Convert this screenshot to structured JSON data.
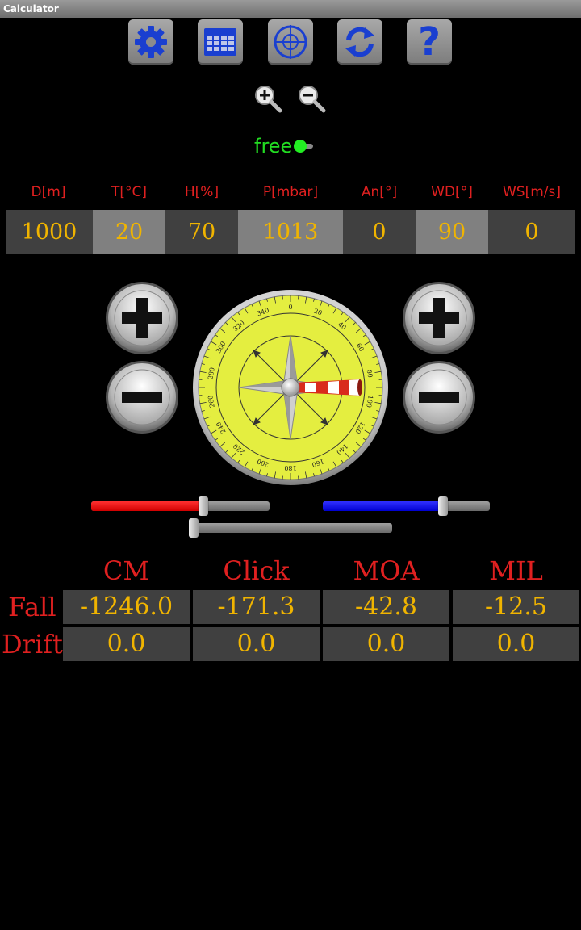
{
  "window": {
    "title": "Calculator"
  },
  "toolbar": [
    {
      "icon": "gear-icon"
    },
    {
      "icon": "table-icon"
    },
    {
      "icon": "crosshair-icon"
    },
    {
      "icon": "refresh-icon"
    },
    {
      "icon": "help-icon",
      "label": "?"
    }
  ],
  "zoom": {
    "in_icon": "zoom-in-icon",
    "out_icon": "zoom-out-icon"
  },
  "mode": {
    "label": "free",
    "enabled": true
  },
  "inputs": {
    "headers": [
      "D[m]",
      "T[°C]",
      "H[%]",
      "P[mbar]",
      "An[°]",
      "WD[°]",
      "WS[m/s]"
    ],
    "values": [
      "1000",
      "20",
      "70",
      "1013",
      "0",
      "90",
      "0"
    ]
  },
  "compass": {
    "wind_direction_deg": 90,
    "tick_labels": [
      "0",
      "20",
      "40",
      "60",
      "80",
      "100",
      "120",
      "140",
      "160",
      "180",
      "200",
      "220",
      "240",
      "260",
      "280",
      "300",
      "320",
      "340"
    ]
  },
  "sliders": {
    "red_level": 0.6,
    "blue_level": 0.69,
    "bottom_level": 0.0
  },
  "results": {
    "columns": [
      "CM",
      "Click",
      "MOA",
      "MIL"
    ],
    "rows": [
      {
        "label": "Fall",
        "values": [
          "-1246.0",
          "-171.3",
          "-42.8",
          "-12.5"
        ]
      },
      {
        "label": "Drift",
        "values": [
          "0.0",
          "0.0",
          "0.0",
          "0.0"
        ]
      }
    ]
  },
  "colors": {
    "accent_red": "#e02020",
    "value_amber": "#f0b400",
    "icon_blue": "#1a3fd0",
    "toggle_green": "#22ee22"
  }
}
